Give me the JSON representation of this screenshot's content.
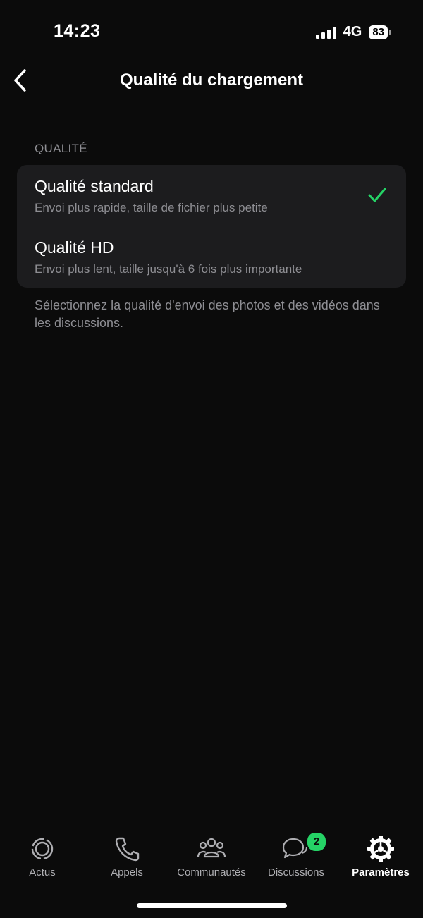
{
  "status_bar": {
    "time": "14:23",
    "network": "4G",
    "battery": "83"
  },
  "nav": {
    "title": "Qualité du chargement"
  },
  "section": {
    "header": "QUALITÉ",
    "options": [
      {
        "title": "Qualité standard",
        "subtitle": "Envoi plus rapide, taille de fichier plus petite",
        "selected": true
      },
      {
        "title": "Qualité HD",
        "subtitle": "Envoi plus lent, taille jusqu'à 6 fois plus importante",
        "selected": false
      }
    ],
    "footer": "Sélectionnez la qualité d'envoi des photos et des vidéos dans les discussions."
  },
  "tabs": [
    {
      "label": "Actus",
      "icon": "status-icon"
    },
    {
      "label": "Appels",
      "icon": "phone-icon"
    },
    {
      "label": "Communautés",
      "icon": "communities-icon"
    },
    {
      "label": "Discussions",
      "icon": "chats-icon",
      "badge": "2"
    },
    {
      "label": "Paramètres",
      "icon": "settings-icon",
      "active": true
    }
  ],
  "colors": {
    "accent": "#25d366",
    "background": "#0b0b0b",
    "card": "#1c1c1e",
    "secondary_text": "#8e8e93"
  }
}
